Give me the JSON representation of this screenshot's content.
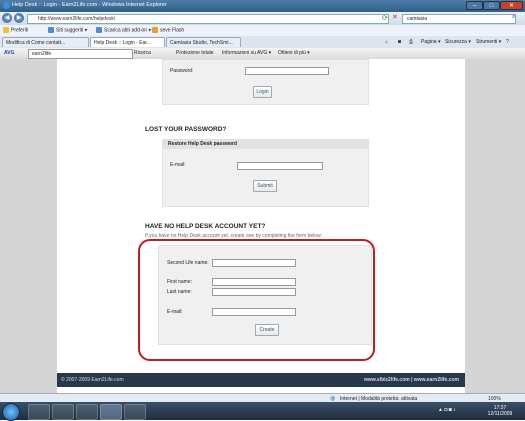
{
  "window": {
    "title": "Help Desk :: Login - Earn2Life.com - Windows Internet Explorer",
    "minimize": "–",
    "maximize": "□",
    "close": "✕"
  },
  "address_bar": {
    "url": "http://www.earn2life.com/helpdesk/",
    "search_placeholder": "camtasia"
  },
  "favorites_bar": {
    "label": "Preferiti",
    "items": [
      "Siti suggeriti ▾",
      "Scarica altri add-on ▾",
      "seve Flash"
    ]
  },
  "tabs": {
    "items": [
      "Modifica di Come contatt...",
      "Help Desk :: Login - Ear...",
      "Camtasia Studio, TechSmi..."
    ]
  },
  "command_bar": {
    "pagina": "Pagina ▾",
    "sicurezza": "Sicurezza ▾",
    "strumenti": "Strumenti ▾"
  },
  "avg_bar": {
    "brand": "AVG",
    "search_value": "earn2life",
    "items": [
      "Ricerca",
      "Protezione totale",
      "Informazioni su AVG ▾",
      "Ottieni di più ▾"
    ]
  },
  "login": {
    "password_label": "Password:",
    "login_button": "Login"
  },
  "lost_password": {
    "heading": "LOST YOUR PASSWORD?",
    "panel_title": "Restore Help Desk password",
    "email_label": "E-mail:",
    "submit_button": "Submit"
  },
  "register": {
    "heading": "HAVE NO HELP DESK ACCOUNT YET?",
    "intro": "If you have no Help Desk account yet, create one by completing the form below:",
    "second_life_label": "Second Life name:",
    "first_name_label": "First name:",
    "last_name_label": "Last name:",
    "email_label": "E-mail:",
    "create_button": "Create"
  },
  "footer": {
    "copyright": "© 2007-2009 Earn2Life.com",
    "links": "www.slbiz2life.com | www.earn2life.com"
  },
  "status_bar": {
    "zone": "Internet | Modalità protetta: attivata",
    "zoom": "100%"
  },
  "taskbar": {
    "time": "17:37",
    "date": "12/11/2009"
  },
  "colors": {
    "highlight_circle": "#c41a22",
    "footer_bg": "#27384a"
  }
}
